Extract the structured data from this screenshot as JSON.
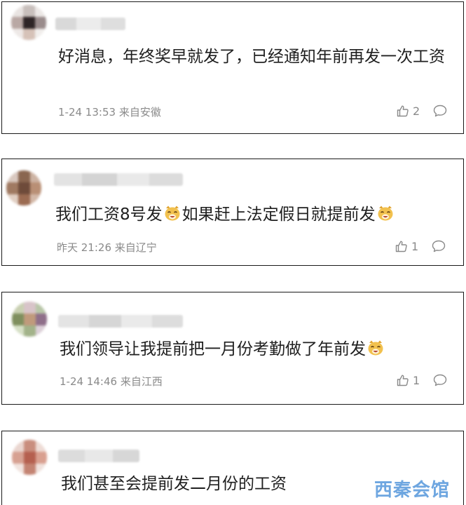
{
  "comments": [
    {
      "text": "好消息，年终奖早就发了，已经通知年前再发一次工资",
      "time": "1-24 13:53",
      "location": "来自安徽",
      "likes": "2"
    },
    {
      "text_part1": "我们工资8号发",
      "text_part2": "如果赶上法定假日就提前发",
      "time": "昨天 21:26",
      "location": "来自辽宁",
      "likes": "1"
    },
    {
      "text": "我们领导让我提前把一月份考勤做了年前发",
      "time": "1-24 14:46",
      "location": "来自江西",
      "likes": "1"
    },
    {
      "text": "我们甚至会提前发二月份的工资"
    }
  ],
  "icons": {
    "like": "thumbs-up-icon",
    "reply": "comment-bubble-icon",
    "emoji": "laughing-dog-emoji"
  },
  "watermark": "西秦会馆",
  "colors": {
    "meta": "#8a8a8a",
    "border": "#1a1a1a",
    "watermark": "#4a90d9"
  }
}
